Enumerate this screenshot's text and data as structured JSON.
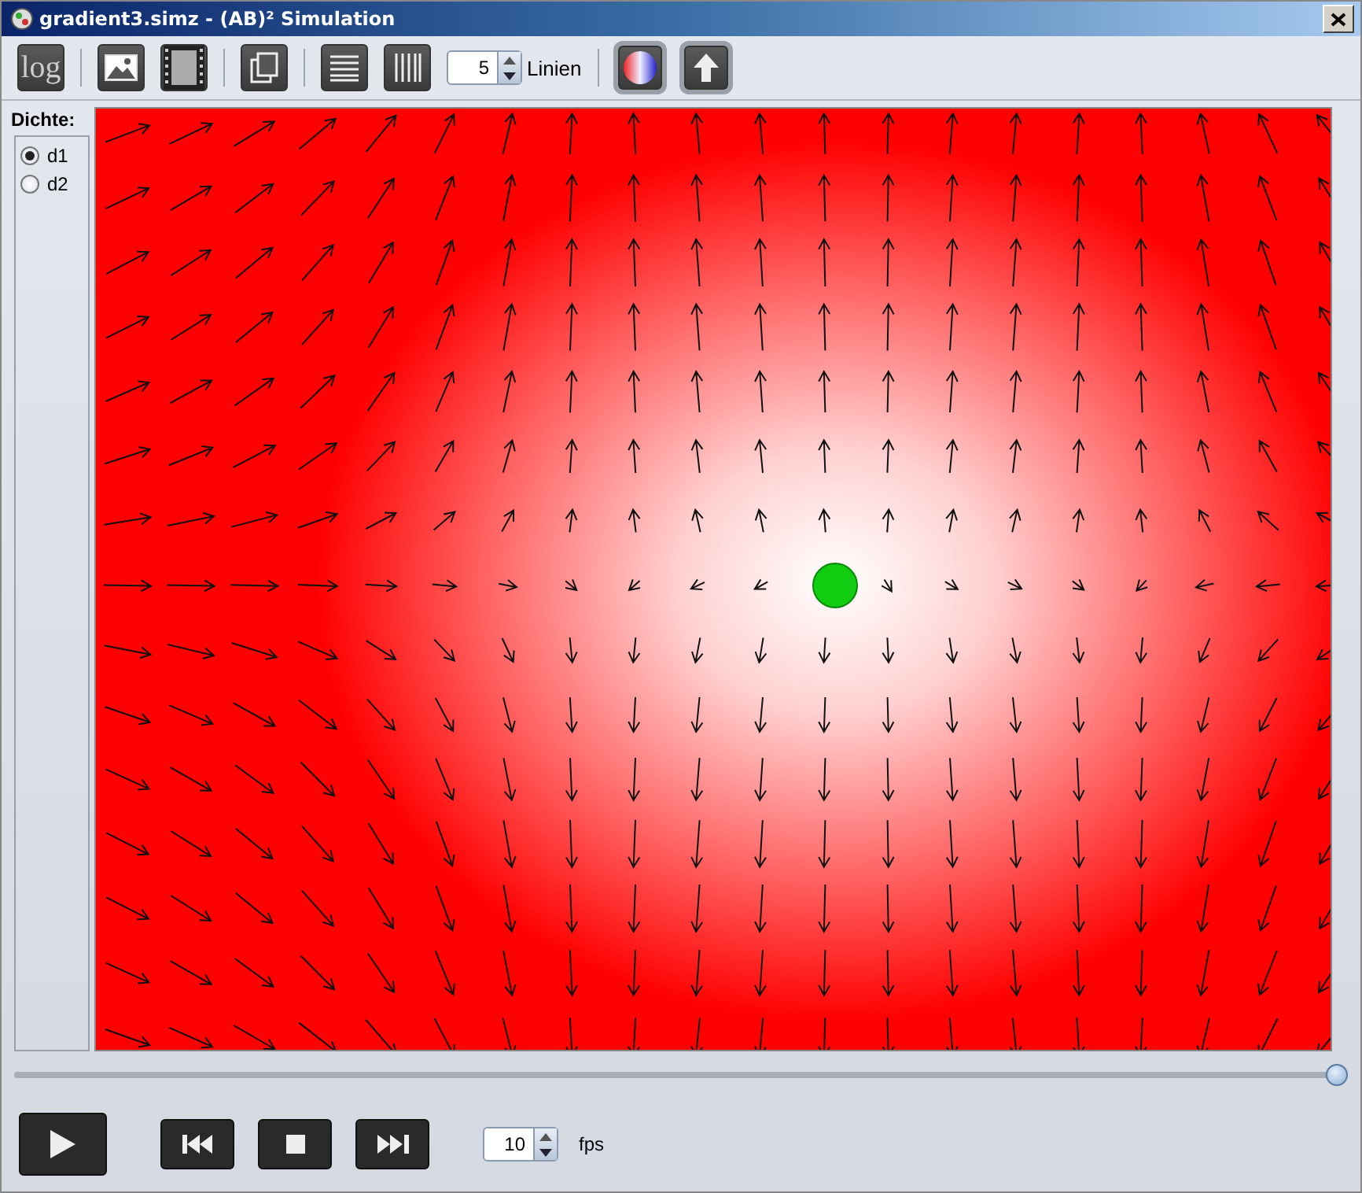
{
  "window": {
    "title": "gradient3.simz - (AB)² Simulation"
  },
  "toolbar": [
    {
      "kind": "text",
      "label": "log",
      "pressed": false
    },
    {
      "kind": "separator"
    },
    {
      "kind": "image",
      "pressed": false
    },
    {
      "kind": "film",
      "pressed": false
    },
    {
      "kind": "separator"
    },
    {
      "kind": "copy",
      "pressed": false
    },
    {
      "kind": "separator"
    },
    {
      "kind": "hlines",
      "pressed": false
    },
    {
      "kind": "vlines",
      "pressed": false
    },
    {
      "kind": "spinner",
      "value": "5",
      "label": "Linien"
    },
    {
      "kind": "separator"
    },
    {
      "kind": "color",
      "pressed": true
    },
    {
      "kind": "up",
      "pressed": true
    }
  ],
  "density_panel": {
    "title": "Dichte:",
    "options": [
      {
        "label": "d1",
        "selected": true
      },
      {
        "label": "d2",
        "selected": false
      }
    ]
  },
  "timeline": {
    "level": 1.0
  },
  "controls": [
    {
      "kind": "play"
    },
    {
      "kind": "rewind"
    },
    {
      "kind": "stop"
    },
    {
      "kind": "forward"
    }
  ],
  "fps": {
    "value": "10",
    "label": "fps"
  }
}
